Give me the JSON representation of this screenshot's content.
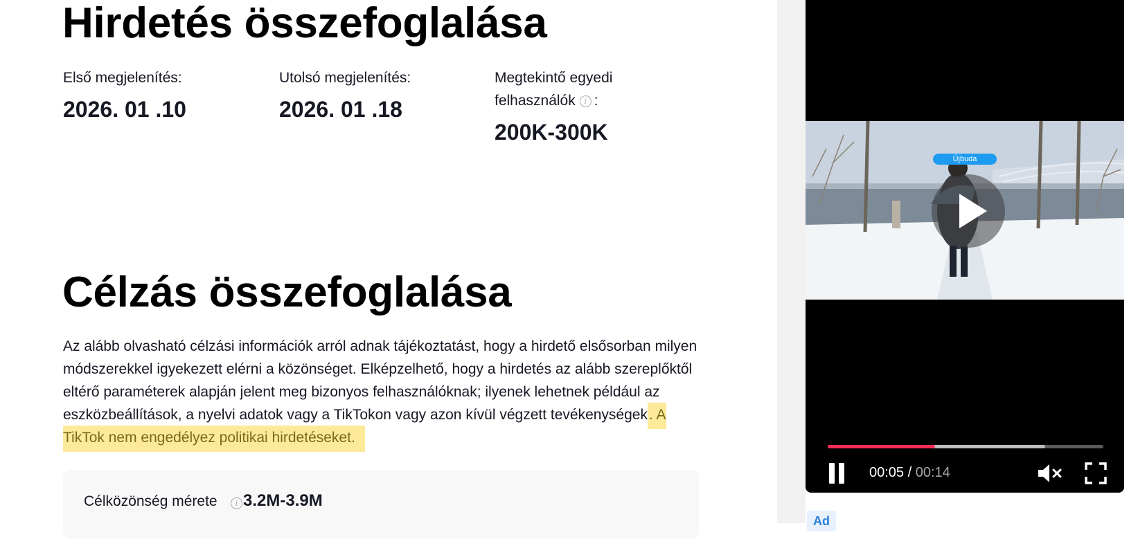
{
  "ad_summary": {
    "title": "Hirdetés összefoglalása",
    "first_seen_label": "Első megjelenítés:",
    "first_seen_value": "2026. 01 .10",
    "last_seen_label": "Utolsó megjelenítés:",
    "last_seen_value": "2026. 01 .18",
    "unique_users_label_line1": "Megtekintő egyedi",
    "unique_users_label_line2": "felhasználók",
    "unique_users_label_suffix": ":",
    "unique_users_value": "200K-300K"
  },
  "targeting": {
    "title": "Célzás összefoglalása",
    "description": "Az alább olvasható célzási információk arról adnak tájékoztatást, hogy a hirdető elsősorban milyen módszerekkel igyekezett elérni a közönséget. Elképzelhető, hogy a hirdetés az alább szereplőktől eltérő paraméterek alapján jelent meg bizonyos felhasználóknak; ilyenek lehetnek például az eszközbeállítások, a nyelvi adatok vagy a TikTokon vagy azon kívül végzett tevékenységek",
    "highlight_text": ". A TikTok nem engedélyez politikai hirdetéseket.",
    "audience_size_label": "Célközönség mérete",
    "audience_size_value": "3.2M-3.9M"
  },
  "player": {
    "location_tag": "Újbuda",
    "current_time": "00:05",
    "separator": " / ",
    "duration": "00:14",
    "played_fraction": 0.39,
    "buffered_fraction": 0.79,
    "state": "paused",
    "muted": true,
    "progress_color": "#fe2c55"
  },
  "ad_badge": "Ad",
  "icons": [
    "info-icon",
    "play-icon",
    "pause-icon",
    "mute-icon",
    "fullscreen-icon"
  ]
}
